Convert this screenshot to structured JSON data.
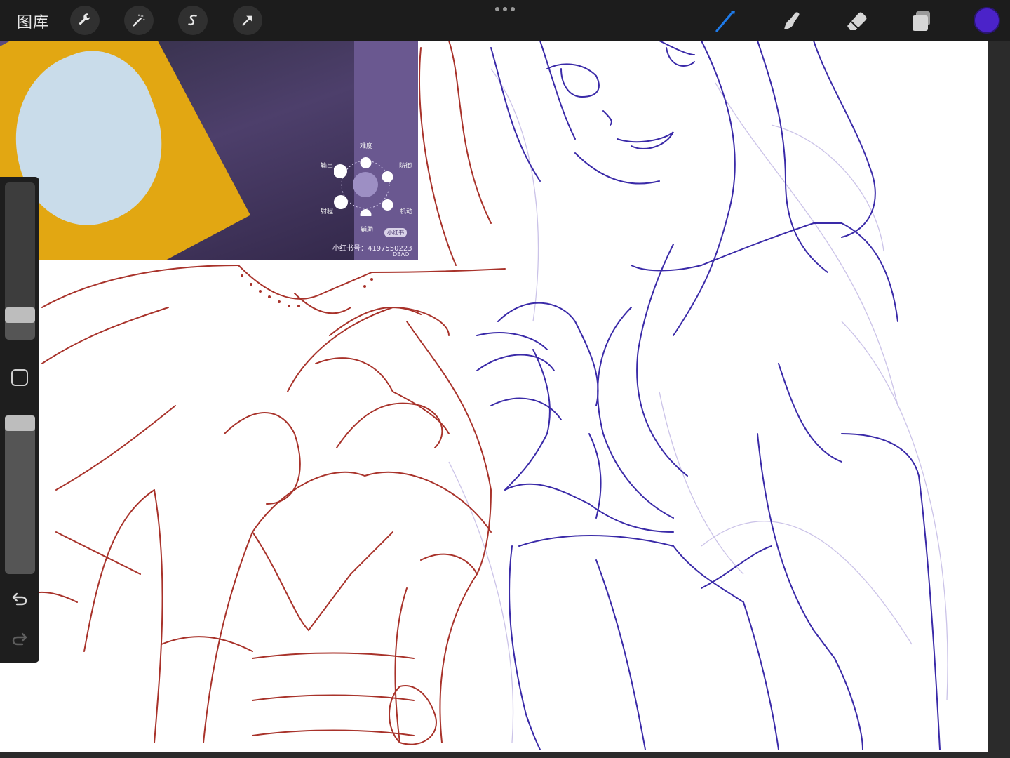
{
  "toolbar": {
    "gallery_label": "图库",
    "left_tools": [
      "wrench-icon",
      "magic-wand-icon",
      "selection-s-icon",
      "transform-arrow-icon"
    ],
    "right_tools": [
      "brush-icon",
      "smudge-icon",
      "eraser-icon",
      "layers-icon"
    ],
    "active_tool": "brush",
    "current_color": "#4b23c9"
  },
  "reference": {
    "stats": {
      "top": "难度",
      "top_right": "防御",
      "left": "输出",
      "bottom_left": "射程",
      "bottom_right": "机动",
      "bottom": "辅助"
    },
    "badge": "小红书",
    "account_id": "小红书号：4197550223",
    "watermark": "DBAO"
  },
  "sidebar": {
    "brush_size": 0.12,
    "opacity": 1.0
  },
  "colors": {
    "stroke_red": "#a8322a",
    "stroke_blue": "#3a2aa8",
    "sketch_light": "#c8c0e6"
  }
}
